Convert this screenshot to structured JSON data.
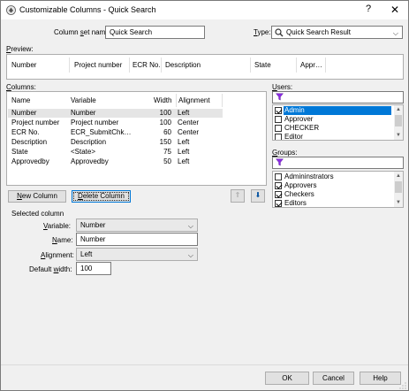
{
  "window": {
    "title": "Customizable Columns - Quick Search",
    "help_glyph": "?",
    "close_glyph": "✕"
  },
  "form": {
    "column_set_label": "Column set name:",
    "column_set_value": "Quick Search",
    "type_label": "Type:",
    "type_value": "Quick Search Result"
  },
  "preview": {
    "label": "Preview:",
    "headers": [
      "Number",
      "Project number",
      "ECR No.",
      "Description",
      "State",
      "Appr…"
    ]
  },
  "columns": {
    "label": "Columns:",
    "headers": {
      "name": "Name",
      "variable": "Variable",
      "width": "Width",
      "alignment": "Alignment"
    },
    "rows": [
      {
        "name": "Number",
        "variable": "Number",
        "width": "100",
        "alignment": "Left"
      },
      {
        "name": "Project number",
        "variable": "Project number",
        "width": "100",
        "alignment": "Center"
      },
      {
        "name": "ECR No.",
        "variable": "ECR_SubmitChk…",
        "width": "60",
        "alignment": "Center"
      },
      {
        "name": "Description",
        "variable": "Description",
        "width": "150",
        "alignment": "Left"
      },
      {
        "name": "State",
        "variable": "<State>",
        "width": "75",
        "alignment": "Left"
      },
      {
        "name": "Approvedby",
        "variable": "Approvedby",
        "width": "50",
        "alignment": "Left"
      }
    ],
    "new_column_label": "New Column",
    "delete_column_label": "Delete Column",
    "move_up_glyph": "⇑",
    "move_down_glyph": "⬇"
  },
  "users": {
    "label": "Users:",
    "filter_icon": "filter-icon",
    "items": [
      {
        "label": "Admin",
        "checked": true,
        "selected": true
      },
      {
        "label": "Approver",
        "checked": false,
        "selected": false
      },
      {
        "label": "CHECKER",
        "checked": false,
        "selected": false
      },
      {
        "label": "Editor",
        "checked": false,
        "selected": false
      }
    ]
  },
  "groups": {
    "label": "Groups:",
    "filter_icon": "filter-icon",
    "items": [
      {
        "label": "Admininstrators",
        "checked": false
      },
      {
        "label": "Approvers",
        "checked": true
      },
      {
        "label": "Checkers",
        "checked": true
      },
      {
        "label": "Editors",
        "checked": true
      }
    ]
  },
  "selected_column": {
    "section_label": "Selected column",
    "variable_label": "Variable:",
    "variable_value": "Number",
    "name_label": "Name:",
    "name_value": "Number",
    "alignment_label": "Alignment:",
    "alignment_value": "Left",
    "default_width_label": "Default width:",
    "default_width_value": "100"
  },
  "footer": {
    "ok_label": "OK",
    "cancel_label": "Cancel",
    "help_label": "Help"
  },
  "colors": {
    "selection": "#0078d7",
    "row_highlight": "#e5e5e5",
    "filter_icon": "#8a2be2"
  }
}
